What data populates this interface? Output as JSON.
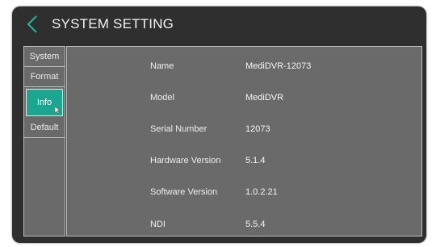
{
  "header": {
    "title": "SYSTEM SETTING",
    "back_icon": "chevron-left-icon"
  },
  "colors": {
    "accent": "#1aa68f",
    "panel": "#6a6a6a",
    "frame": "#2f2f2f"
  },
  "sidebar": {
    "items": [
      {
        "label": "System",
        "active": false
      },
      {
        "label": "Format",
        "active": false
      },
      {
        "label": "Info",
        "active": true
      },
      {
        "label": "Default",
        "active": false
      }
    ]
  },
  "info": {
    "rows": [
      {
        "label": "Name",
        "value": "MediDVR-12073"
      },
      {
        "label": "Model",
        "value": "MediDVR"
      },
      {
        "label": "Serial Number",
        "value": "12073"
      },
      {
        "label": "Hardware Version",
        "value": "5.1.4"
      },
      {
        "label": "Software Version",
        "value": "1.0.2.21"
      },
      {
        "label": "NDI",
        "value": "5.5.4"
      }
    ]
  }
}
